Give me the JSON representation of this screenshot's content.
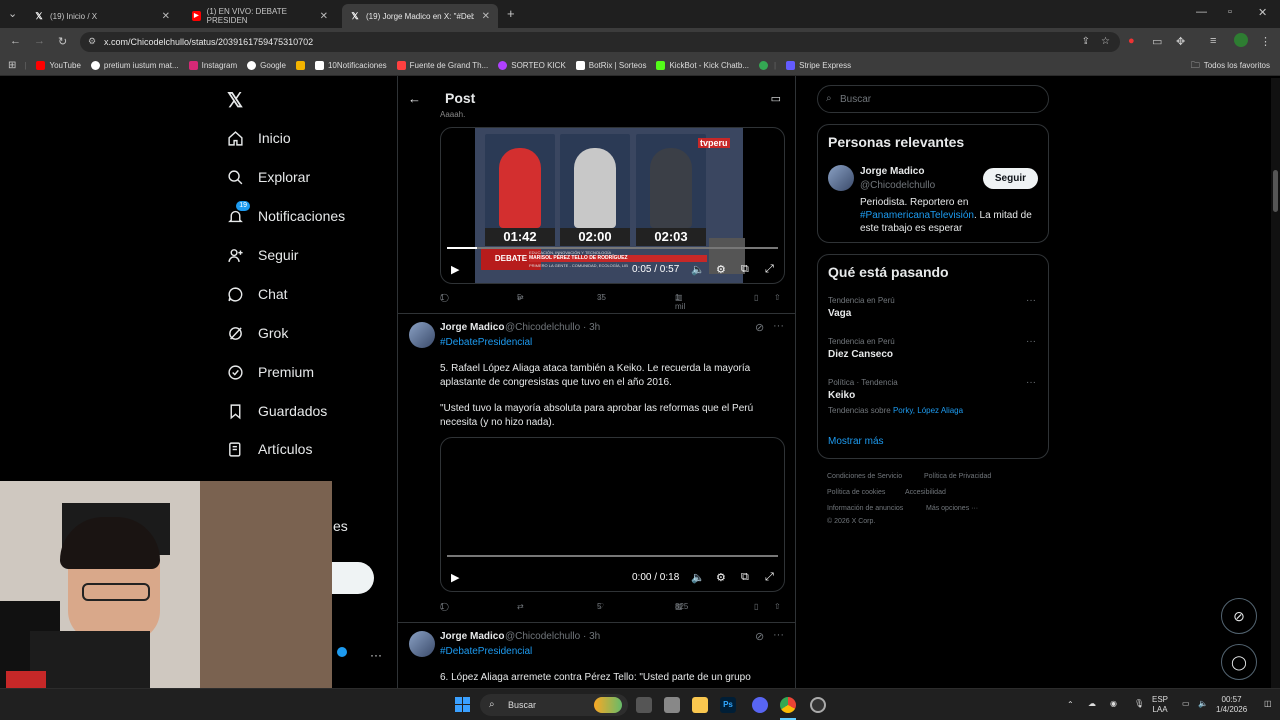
{
  "browser": {
    "tabs": [
      {
        "label": "(19) Inicio / X",
        "icon": "x-logo-icon",
        "active": false
      },
      {
        "label": "(1) EN VIVO: DEBATE PRESIDEN",
        "icon": "youtube-icon",
        "active": false
      },
      {
        "label": "(19) Jorge Madico en X: \"#Deba",
        "icon": "x-logo-icon",
        "active": true
      }
    ],
    "new_tab": "+",
    "url": "x.com/Chicodelchullo/status/2039161759475310702",
    "bookmarks": [
      {
        "label": "YouTube",
        "color": "#ff0000"
      },
      {
        "label": "pretium iustum mat...",
        "color": "#ffffff"
      },
      {
        "label": "Instagram",
        "color": "#d62976"
      },
      {
        "label": "Google",
        "color": "#4285f4"
      },
      {
        "label": "",
        "color": "#f4b400"
      },
      {
        "label": "10Notificaciones",
        "color": "#ffffff"
      },
      {
        "label": "Fuente de Grand Th...",
        "color": "#ff4040"
      },
      {
        "label": "SORTEO KICK",
        "color": "#b040ff"
      },
      {
        "label": "BotRix | Sorteos",
        "color": "#ffffff"
      },
      {
        "label": "KickBot - Kick Chatb...",
        "color": "#53fc18"
      },
      {
        "label": "",
        "color": "#34a853"
      },
      {
        "label": "Stripe Express",
        "color": "#635bff"
      }
    ],
    "all_bookmarks": "Todos los favoritos"
  },
  "nav": {
    "items": [
      {
        "label": "Inicio",
        "icon": "home-icon",
        "glyph": "⌂"
      },
      {
        "label": "Explorar",
        "icon": "search-icon",
        "glyph": "⌕"
      },
      {
        "label": "Notificaciones",
        "icon": "bell-icon",
        "glyph": "🔔",
        "badge": "19"
      },
      {
        "label": "Seguir",
        "icon": "add-user-icon",
        "glyph": "👤"
      },
      {
        "label": "Chat",
        "icon": "chat-icon",
        "glyph": "◯"
      },
      {
        "label": "Grok",
        "icon": "grok-icon",
        "glyph": "⊘"
      },
      {
        "label": "Premium",
        "icon": "verified-icon",
        "glyph": "✓"
      },
      {
        "label": "Guardados",
        "icon": "bookmark-icon",
        "glyph": "▯"
      },
      {
        "label": "Artículos",
        "icon": "article-icon",
        "glyph": "≣"
      }
    ],
    "more_partial": "es",
    "account_more": "···"
  },
  "post": {
    "title": "Post",
    "partial_text_top": "Aaaah."
  },
  "video1": {
    "timers": [
      "01:42",
      "02:00",
      "02:03"
    ],
    "channel": "tvperu",
    "banner_top": "EDUCACIÓN, INNOVACIÓN Y TECNOLOGÍA",
    "banner_name": "MARISOL PÉREZ TELLO DE RODRÍGUEZ",
    "banner_sub": "PRIMERO LA GENTE - COMUNIDAD, ECOLOGÍA, LIB",
    "debate_label": "DEBATE",
    "time": "0:05 / 0:57",
    "progress": 0.09
  },
  "stats1": {
    "replies": "1",
    "reposts": "5",
    "likes": "35",
    "views": "1 mil"
  },
  "tweet2": {
    "name": "Jorge Madico",
    "handle": "@Chicodelchullo · 3h",
    "hashtag": "#DebatePresidencial",
    "text1": "5. Rafael López Aliaga ataca también a  Keiko. Le recuerda la mayoría aplastante de congresistas que tuvo en el año 2016.",
    "text2": "\"Usted tuvo la mayoría absoluta para aprobar las reformas que el Perú necesita (y no hizo nada).",
    "video_time": "0:00 / 0:18",
    "progress": 0.0
  },
  "stats2": {
    "replies": "1",
    "reposts": "",
    "likes": "5",
    "views": "825"
  },
  "tweet3": {
    "name": "Jorge Madico",
    "handle": "@Chicodelchullo · 3h",
    "hashtag": "#DebatePresidencial",
    "text1": "6. López Aliaga arremete contra Pérez Tello: \"Usted parte de un grupo"
  },
  "right": {
    "search_placeholder": "Buscar",
    "relevant": {
      "title": "Personas relevantes",
      "name": "Jorge Madico",
      "handle": "@Chicodelchullo",
      "follow": "Seguir",
      "bio1": "Periodista. Reportero en",
      "bio_link": "#PanamericanaTelevisión",
      "bio2": ". La mitad de este trabajo es esperar"
    },
    "trending": {
      "title": "Qué está pasando",
      "items": [
        {
          "meta": "Tendencia en Perú",
          "name": "Vaga"
        },
        {
          "meta": "Tendencia en Perú",
          "name": "Diez Canseco"
        },
        {
          "meta": "Política · Tendencia",
          "name": "Keiko",
          "related_prefix": "Tendencias sobre",
          "related": "Porky, López Aliaga"
        }
      ],
      "show_more": "Mostrar más"
    },
    "footer": [
      "Condiciones de Servicio",
      "Política de Privacidad",
      "Política de cookies",
      "Accesibilidad",
      "Información de anuncios",
      "Más opciones ···",
      "© 2026 X Corp."
    ]
  },
  "taskbar": {
    "search": "Buscar",
    "lang1": "ESP",
    "lang2": "LAA",
    "time": "00:57",
    "date": "1/4/2026"
  }
}
